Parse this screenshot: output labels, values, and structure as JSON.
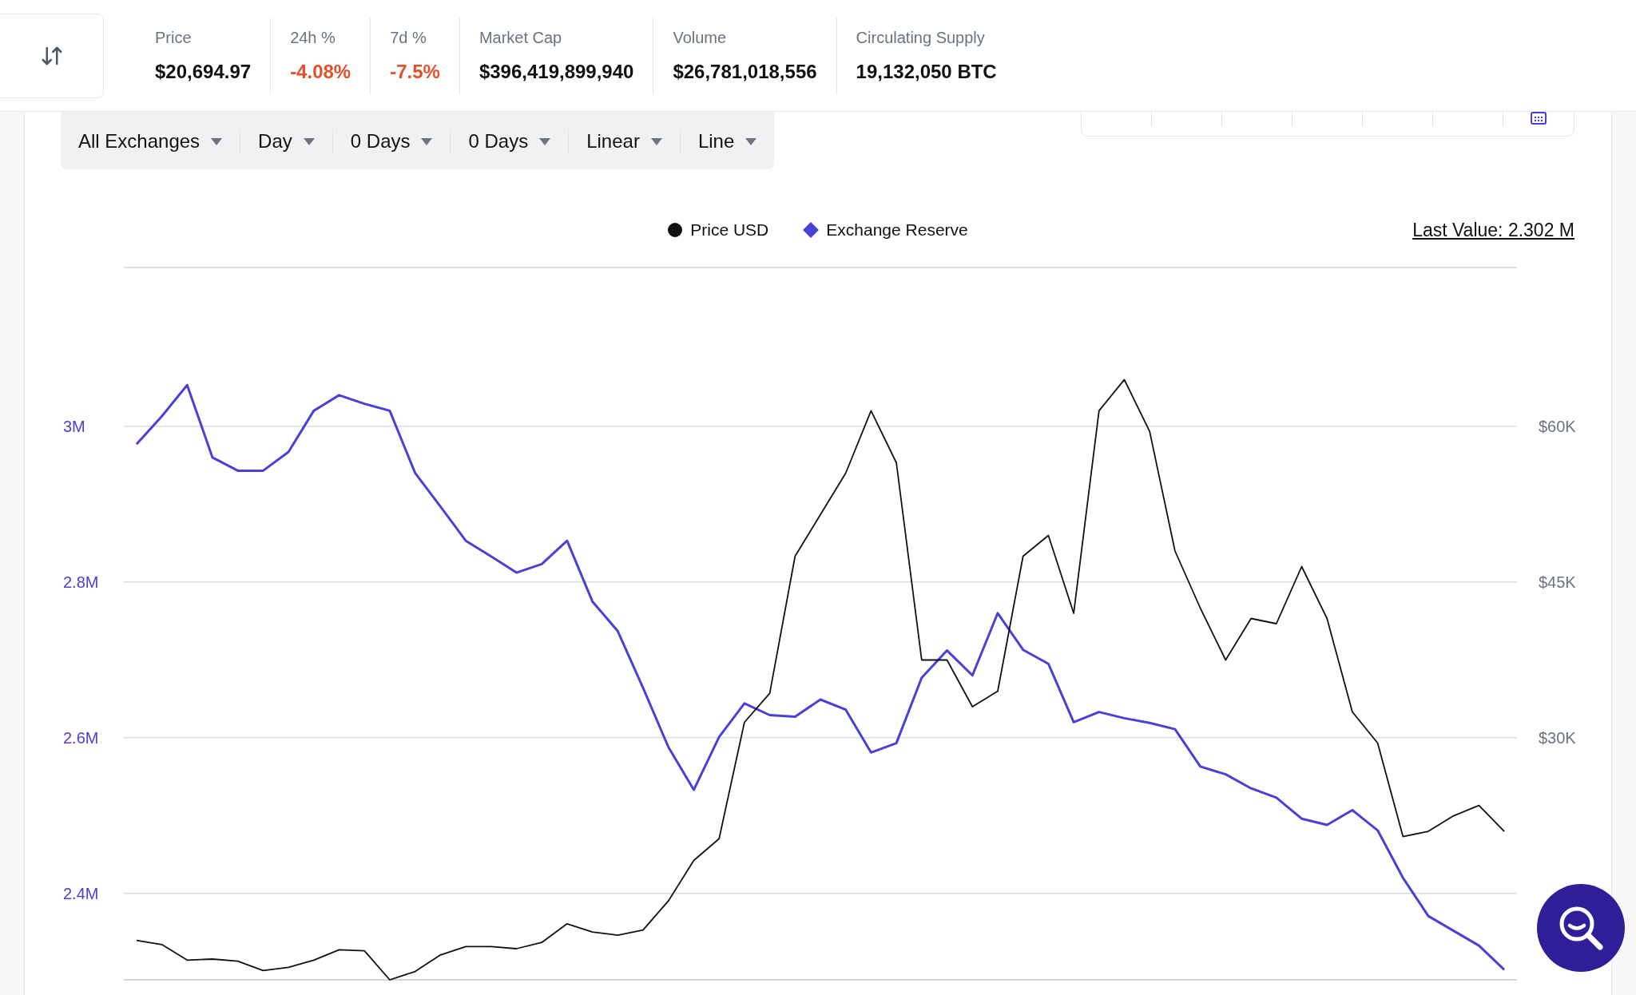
{
  "stats_bar": {
    "items": [
      {
        "label": "Price",
        "value": "$20,694.97",
        "color": "#111111"
      },
      {
        "label": "24h %",
        "value": "-4.08%",
        "color": "#e0522b"
      },
      {
        "label": "7d %",
        "value": "-7.5%",
        "color": "#e0522b"
      },
      {
        "label": "Market Cap",
        "value": "$396,419,899,940",
        "color": "#111111"
      },
      {
        "label": "Volume",
        "value": "$26,781,018,556",
        "color": "#111111"
      },
      {
        "label": "Circulating Supply",
        "value": "19,132,050 BTC",
        "color": "#111111"
      }
    ]
  },
  "filters": [
    {
      "value": "All Exchanges"
    },
    {
      "value": "Day"
    },
    {
      "value": "0 Days"
    },
    {
      "value": "0 Days"
    },
    {
      "value": "Linear"
    },
    {
      "value": "Line"
    }
  ],
  "chart": {
    "last_value": "Last Value: 2.302 M",
    "reserve_panel": {
      "chart_data": {
        "type": "line",
        "grid": true,
        "ylim": [
          2289000,
          3204000
        ],
        "yticks": [
          {
            "value": 3000000,
            "label": "3M"
          },
          {
            "value": 2800000,
            "label": "2.8M"
          },
          {
            "value": 2600000,
            "label": "2.6M"
          },
          {
            "value": 2400000,
            "label": "2.4M"
          }
        ],
        "series": [
          {
            "name": "Exchange Reserve",
            "color": "#4a3fd6",
            "values": [
              2977000,
              3013000,
              3053000,
              2960000,
              2943000,
              2943000,
              2967000,
              3020000,
              3040000,
              3029000,
              3020000,
              2940000,
              2897000,
              2853000,
              2833000,
              2812000,
              2823000,
              2853000,
              2775000,
              2737000,
              2664000,
              2588000,
              2533000,
              2601000,
              2644000,
              2629000,
              2627000,
              2649000,
              2636000,
              2581000,
              2593000,
              2677000,
              2712000,
              2680000,
              2760000,
              2713000,
              2695000,
              2620000,
              2633000,
              2625000,
              2619000,
              2611000,
              2563000,
              2553000,
              2535000,
              2523000,
              2496000,
              2488000,
              2507000,
              2481000,
              2420000,
              2371000,
              2352000,
              2333000,
              2302000
            ]
          }
        ]
      }
    },
    "price_panel": {
      "chart_data": {
        "type": "line",
        "ylim": [
          6700,
          75300
        ],
        "yticks": [
          {
            "value": 60000,
            "label": "$60K"
          },
          {
            "value": 45000,
            "label": "$45K"
          },
          {
            "value": 30000,
            "label": "$30K"
          }
        ],
        "series": [
          {
            "name": "Price USD",
            "color": "#111111",
            "values": [
              10500,
              10100,
              8600,
              8700,
              8500,
              7600,
              7900,
              8600,
              9600,
              9500,
              6700,
              7500,
              9100,
              9900,
              9900,
              9700,
              10300,
              12100,
              11300,
              11000,
              11500,
              14300,
              18200,
              20300,
              31500,
              34300,
              47500,
              51500,
              55500,
              61500,
              56500,
              37500,
              37500,
              33000,
              34500,
              47500,
              49500,
              42000,
              61500,
              64500,
              59500,
              48000,
              42500,
              37500,
              41500,
              41000,
              46500,
              41500,
              32500,
              29500,
              20500,
              21000,
              22500,
              23500,
              21000
            ]
          }
        ]
      }
    }
  }
}
